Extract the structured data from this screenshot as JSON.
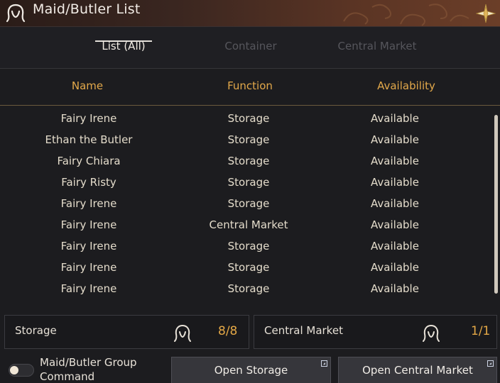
{
  "window": {
    "title": "Maid/Butler List",
    "title_icon": "maid-icon",
    "corner_icon": "star-flower-icon",
    "colors": {
      "accent": "#e4a846",
      "title_bar": "#5a3424",
      "background": "#1c1c1f"
    }
  },
  "tabs": [
    {
      "label": "List (All)",
      "active": true
    },
    {
      "label": "Container",
      "active": false
    },
    {
      "label": "Central Market",
      "active": false
    }
  ],
  "table": {
    "columns": [
      "Name",
      "Function",
      "Availability"
    ],
    "rows": [
      {
        "name": "Fairy Irene",
        "function": "Storage",
        "availability": "Available"
      },
      {
        "name": "Ethan the Butler",
        "function": "Storage",
        "availability": "Available"
      },
      {
        "name": "Fairy Chiara",
        "function": "Storage",
        "availability": "Available"
      },
      {
        "name": "Fairy Risty",
        "function": "Storage",
        "availability": "Available"
      },
      {
        "name": "Fairy Irene",
        "function": "Storage",
        "availability": "Available"
      },
      {
        "name": "Fairy Irene",
        "function": "Central Market",
        "availability": "Available"
      },
      {
        "name": "Fairy Irene",
        "function": "Storage",
        "availability": "Available"
      },
      {
        "name": "Fairy Irene",
        "function": "Storage",
        "availability": "Available"
      },
      {
        "name": "Fairy Irene",
        "function": "Storage",
        "availability": "Available"
      }
    ]
  },
  "summary": {
    "storage": {
      "label": "Storage",
      "value": "8/8",
      "icon": "maid-icon"
    },
    "market": {
      "label": "Central Market",
      "value": "1/1",
      "icon": "maid-icon"
    }
  },
  "footer": {
    "group_command_label": "Maid/Butler Group Command",
    "group_command_enabled": false,
    "open_storage_label": "Open Storage",
    "open_market_label": "Open Central Market",
    "button_corner_icon": "expand-corner-icon"
  }
}
